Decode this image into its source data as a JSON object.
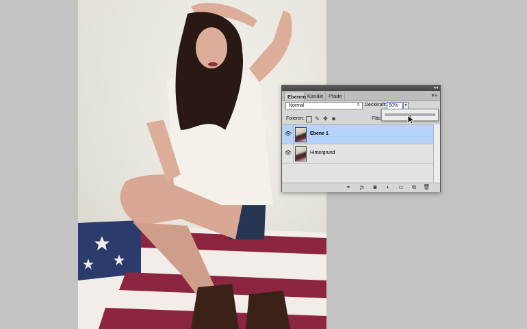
{
  "panel": {
    "tabs": [
      {
        "label": "Ebenen",
        "active": true
      },
      {
        "label": "Kanäle",
        "active": false
      },
      {
        "label": "Pfade",
        "active": false
      }
    ],
    "collapse_glyph": "◂◂",
    "menu_glyph": "▾≡",
    "blend_mode": "Normal",
    "opacity_label": "Deckkraft:",
    "opacity_value": "50%",
    "opacity_fraction": 0.5,
    "lock_label": "Fixieren:",
    "fill_label": "Fläc",
    "layers": [
      {
        "name": "Ebene 1",
        "selected": true
      },
      {
        "name": "Hintergrund",
        "selected": false
      }
    ],
    "accent_color": "#b5d3fb"
  },
  "icons": {
    "eye": "eye-icon",
    "lock_transparent": "lock-transparent-icon",
    "lock_image": "brush-icon",
    "lock_position": "move-icon",
    "lock_all": "lock-icon",
    "link": "link-icon",
    "fx": "fx-icon",
    "mask": "mask-icon",
    "adjustment": "adjustment-icon",
    "group": "folder-icon",
    "new_layer": "new-layer-icon",
    "trash": "trash-icon"
  }
}
